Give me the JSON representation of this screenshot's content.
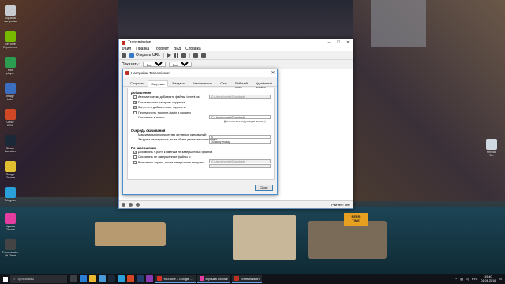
{
  "desktop": {
    "icons": [
      {
        "label": "Корзина\nнастройки",
        "color": "#c8ccd0"
      },
      {
        "label": "GeForce\nExperience",
        "color": "#76b900"
      },
      {
        "label": "Nox\nplayer",
        "color": "#2a9d50"
      },
      {
        "label": "Image\nfolder",
        "color": "#3a6fc0"
      },
      {
        "label": "Office\n2016",
        "color": "#d24726"
      },
      {
        "label": "Steam\nLauncher",
        "color": "#1b2838"
      },
      {
        "label": "Google\nChrome",
        "color": "#e0c030"
      },
      {
        "label": "Telegram",
        "color": "#2aa0da"
      },
      {
        "label": "Музыка\nGroove",
        "color": "#e43da0"
      },
      {
        "label": "Transmission\nQt Client",
        "color": "#444"
      }
    ],
    "right_icon_label": "Recycle\nBin",
    "wallpaper_sign": "BEER\nTIME"
  },
  "window": {
    "title": "Transmission",
    "menu": [
      "Файл",
      "Правка",
      "Торрент",
      "Вид",
      "Справка"
    ],
    "toolbar": {
      "open_url": "Открыть URL"
    },
    "filter": {
      "show_label": "Показать:",
      "show_value": "Все",
      "all_value": "Все"
    },
    "status": {
      "mode": "Рейтинг: Нет"
    }
  },
  "dialog": {
    "title": "Настройки Transmission",
    "close_x": "✕",
    "tabs": [
      "Скорость",
      "Загрузка",
      "Раздача",
      "Безопасность",
      "Сеть",
      "Рабочий стол",
      "Удалённый доступ"
    ],
    "active_tab": 1,
    "sections": {
      "adding": "Добавление",
      "queue": "Очередь скачивания",
      "done": "По завершении"
    },
    "adding": {
      "auto_add": "Автоматически добавлять файлы .torrent из:",
      "auto_add_path": "C:/Users/yuemih/Downloads",
      "show_options": "Показать окно настроек торрента",
      "start_added": "Запустить добавленные торренты",
      "trash": "Переместить торрент-файл в корзину",
      "save_to": "Сохранять в папку:",
      "save_to_path": "C:/Users/yuemih/Downloads",
      "free_space": "Доступно места (проверка места...)"
    },
    "queue": {
      "max_active": "Максимальное количество активных скачиваний:",
      "max_active_value": "5",
      "stalled": "Загрузка неактуальна, если обмен данными остановлен:",
      "stalled_value": "30 минут назад"
    },
    "done": {
      "append_part": "Добавлять «.part» к именам не завершённых файлов",
      "keep_incomplete": "Сохранять не завершенные файлы в:",
      "keep_incomplete_path": "C:/Users/yuemih/Downloads",
      "run_script": "Выполнить скрипт, после завершения загрузки:",
      "run_script_path": ""
    },
    "close_button": "Close"
  },
  "taskbar": {
    "search": "Программы",
    "apps": [
      {
        "label": "YouTube – Google ...",
        "color": "#d93025"
      },
      {
        "label": "Музыка Groove",
        "color": "#e43da0"
      },
      {
        "label": "Transmission",
        "color": "#c03020"
      }
    ],
    "lang": "РУС",
    "time": "19:40",
    "date": "01.06.2016"
  }
}
